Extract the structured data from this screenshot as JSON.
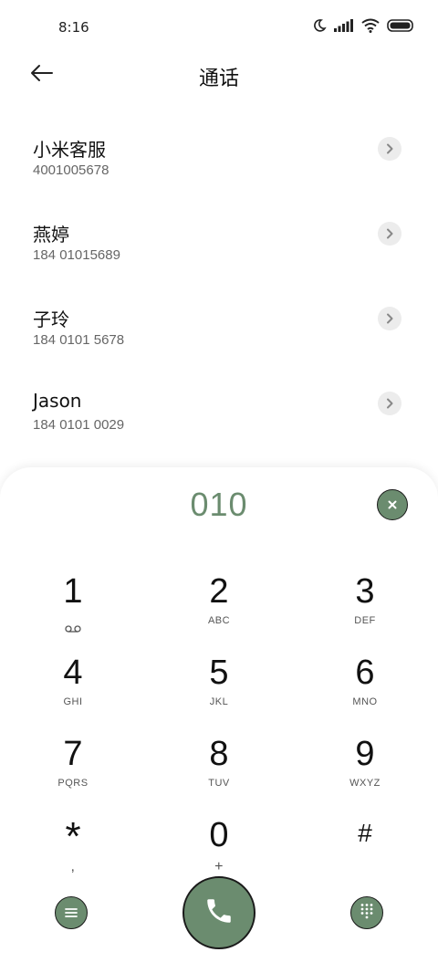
{
  "status_bar": {
    "time": "8:16",
    "icons": [
      "moon-icon",
      "signal-icon",
      "wifi-icon",
      "battery-icon"
    ]
  },
  "header": {
    "back_icon": "back-arrow-icon",
    "title": "通话"
  },
  "contacts": [
    {
      "name": "小米客服",
      "number": "4001005678"
    },
    {
      "name": "燕婷",
      "number": "184 01015689"
    },
    {
      "name": "子玲",
      "number": "184 0101 5678"
    },
    {
      "name": "Jason",
      "number": "184 0101 0029"
    }
  ],
  "dialpad": {
    "input_value": "010",
    "clear_icon": "close-icon",
    "keys": [
      {
        "digit": "1",
        "letters": "",
        "icon": "voicemail-icon"
      },
      {
        "digit": "2",
        "letters": "ABC"
      },
      {
        "digit": "3",
        "letters": "DEF"
      },
      {
        "digit": "4",
        "letters": "GHI"
      },
      {
        "digit": "5",
        "letters": "JKL"
      },
      {
        "digit": "6",
        "letters": "MNO"
      },
      {
        "digit": "7",
        "letters": "PQRS"
      },
      {
        "digit": "8",
        "letters": "TUV"
      },
      {
        "digit": "9",
        "letters": "WXYZ"
      },
      {
        "digit": "*",
        "letters": ","
      },
      {
        "digit": "0",
        "letters": "+"
      },
      {
        "digit": "#",
        "letters": ""
      }
    ]
  },
  "actions": {
    "menu_icon": "menu-icon",
    "call_icon": "phone-icon",
    "keypad_icon": "dialpad-grid-icon"
  },
  "colors": {
    "accent": "#6b8c6f",
    "outline": "#1a1a1a",
    "chip_bg": "#ececec"
  }
}
